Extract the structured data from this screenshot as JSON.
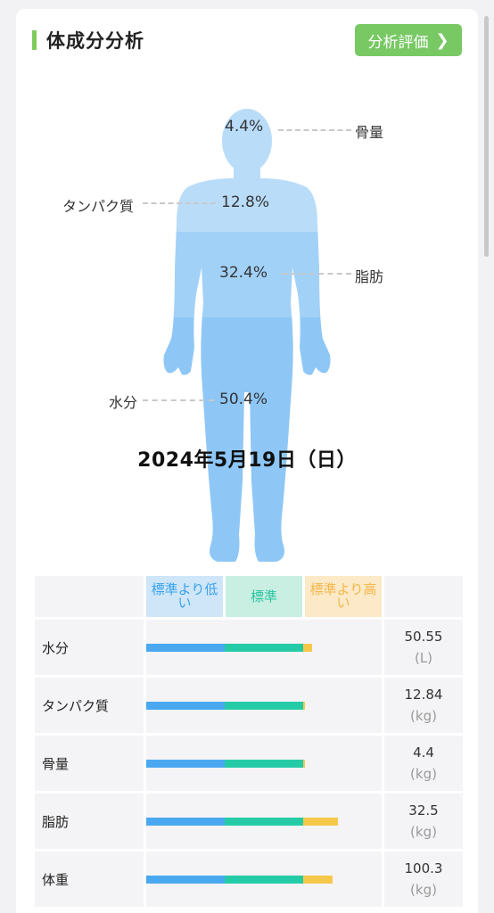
{
  "header": {
    "title": "体成分分析",
    "eval_button_label": "分析評価"
  },
  "figure": {
    "bone_pct": "4.4%",
    "protein_pct": "12.8%",
    "fat_pct": "32.4%",
    "water_pct": "50.4%",
    "bone_label": "骨量",
    "protein_label": "タンパク質",
    "fat_label": "脂肪",
    "water_label": "水分",
    "date": "2024年5月19日（日）"
  },
  "legend": {
    "low": "標準より低い",
    "standard": "標準",
    "high": "標準より高い"
  },
  "rows": [
    {
      "name": "水分",
      "value": "50.55",
      "unit": "(L)",
      "high_fraction": 0.11
    },
    {
      "name": "タンパク質",
      "value": "12.84",
      "unit": "(kg)",
      "high_fraction": 0.02
    },
    {
      "name": "骨量",
      "value": "4.4",
      "unit": "(kg)",
      "high_fraction": 0.02
    },
    {
      "name": "脂肪",
      "value": "32.5",
      "unit": "(kg)",
      "high_fraction": 0.44
    },
    {
      "name": "体重",
      "value": "100.3",
      "unit": "(kg)",
      "high_fraction": 0.37
    }
  ],
  "colors": {
    "accent_green": "#78c964",
    "bar_low": "#4aa8f0",
    "bar_standard": "#25cba6",
    "bar_high": "#f6c84a"
  }
}
